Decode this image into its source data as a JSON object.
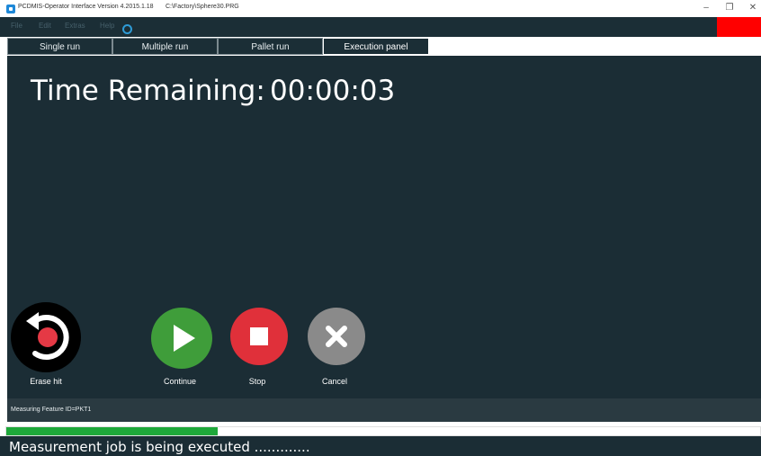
{
  "window": {
    "title": "PCDMIS-Operator Interface  Version 4.2015.1.18",
    "path": "C:\\Factory\\Sphere30.PRG",
    "controls": [
      "–",
      "❐",
      "✕"
    ]
  },
  "menu": {
    "items": [
      "File",
      "Edit",
      "Extras",
      "Help"
    ]
  },
  "tabs": [
    {
      "label": "Single run",
      "active": false
    },
    {
      "label": "Multiple run",
      "active": false
    },
    {
      "label": "Pallet run",
      "active": false
    },
    {
      "label": "Execution panel",
      "active": true
    }
  ],
  "timer": {
    "label": "Time Remaining:",
    "value": "00:00:03"
  },
  "buttons": {
    "erase_hit": {
      "label": "Erase hit",
      "icon": "erase-hit-icon",
      "color": "#000000",
      "accent": "#e53945"
    },
    "continue": {
      "label": "Continue",
      "icon": "play-icon",
      "color": "#3f9d3a"
    },
    "stop": {
      "label": "Stop",
      "icon": "stop-icon",
      "color": "#e0303a"
    },
    "cancel": {
      "label": "Cancel",
      "icon": "close-icon",
      "color": "#8a8a8a"
    }
  },
  "status": {
    "feature_text": "Measuring Feature ID=PKT1"
  },
  "progress": {
    "fraction": 0.28,
    "color": "#1ea83a"
  },
  "bottom": {
    "message": "Measurement job is being executed ............."
  },
  "colors": {
    "accent_red": "#ff0000",
    "panel_bg": "#1b2d35"
  }
}
